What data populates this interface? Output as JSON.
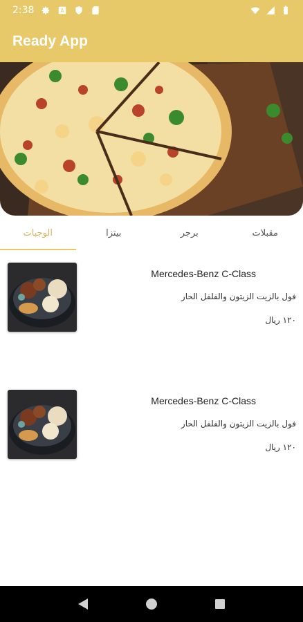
{
  "status_bar": {
    "time": "2:38",
    "icons": [
      "settings-icon",
      "alert-icon",
      "shield-icon",
      "sd-card-icon",
      "wifi-icon",
      "signal-icon",
      "battery-icon"
    ]
  },
  "app_bar": {
    "title": "Ready App"
  },
  "banner": {
    "image": "pizza-banner-image"
  },
  "tabs": [
    {
      "label": "الوجبات",
      "active": true
    },
    {
      "label": "بيتزا",
      "active": false
    },
    {
      "label": "برجر",
      "active": false
    },
    {
      "label": "مقبلات",
      "active": false
    }
  ],
  "items": [
    {
      "title": "Mercedes-Benz C-Class",
      "description": "فول بالزيت الزيتون والفلفل الحار",
      "price": "١٢٠ ريال",
      "image": "mixed-grill-plate-image"
    },
    {
      "title": "Mercedes-Benz C-Class",
      "description": "فول بالزيت الزيتون والفلفل الحار",
      "price": "١٢٠ ريال",
      "image": "mixed-grill-plate-image"
    }
  ],
  "colors": {
    "accent": "#e8c96a",
    "active_tab_text": "#d9b45a",
    "nav_bar": "#000000"
  },
  "nav": {
    "buttons": [
      "back-icon",
      "home-icon",
      "recents-icon"
    ]
  }
}
